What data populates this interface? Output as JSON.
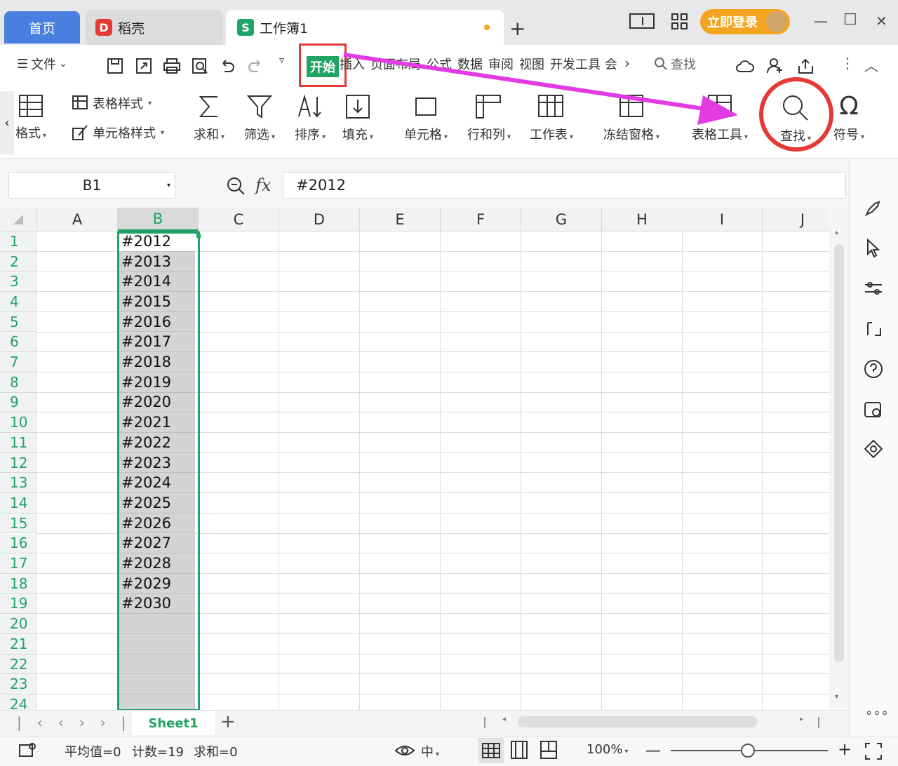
{
  "tabs": {
    "home": "首页",
    "daoke": "稻壳",
    "workbook": "工作簿1",
    "new_tab": "+"
  },
  "titlebar": {
    "login": "立即登录",
    "minimize": "—",
    "maximize": "☐",
    "close": "✕"
  },
  "menu": {
    "file": "文件",
    "start": "开始",
    "insert": "插入",
    "page_layout": "页面布局",
    "formula": "公式",
    "data": "数据",
    "review": "审阅",
    "view": "视图",
    "developer": "开发工具",
    "more": "会",
    "search": "查找"
  },
  "ribbon": {
    "table_format": "格式",
    "table_style": "表格样式",
    "cell_style": "单元格样式",
    "sum": "求和",
    "filter": "筛选",
    "sort": "排序",
    "fill": "填充",
    "cell": "单元格",
    "row_col": "行和列",
    "worksheet": "工作表",
    "freeze": "冻结窗格",
    "table_tools": "表格工具",
    "find": "查找",
    "symbol": "符号"
  },
  "formula_bar": {
    "name_box": "B1",
    "fx": "fx",
    "value": "#2012"
  },
  "columns": [
    "A",
    "B",
    "C",
    "D",
    "E",
    "F",
    "G",
    "H",
    "I",
    "J"
  ],
  "rows": [
    "1",
    "2",
    "3",
    "4",
    "5",
    "6",
    "7",
    "8",
    "9",
    "10",
    "11",
    "12",
    "13",
    "14",
    "15",
    "16",
    "17",
    "18",
    "19",
    "20",
    "21",
    "22",
    "23",
    "24"
  ],
  "column_b_values": [
    "#2012",
    "#2013",
    "#2014",
    "#2015",
    "#2016",
    "#2017",
    "#2018",
    "#2019",
    "#2020",
    "#2021",
    "#2022",
    "#2023",
    "#2024",
    "#2025",
    "#2026",
    "#2027",
    "#2028",
    "#2029",
    "#2030"
  ],
  "sheet": {
    "name": "Sheet1",
    "add": "+"
  },
  "status": {
    "average": "平均值=0",
    "count": "计数=19",
    "sum": "求和=0",
    "zoom": "100%"
  },
  "colors": {
    "accent": "#21a366",
    "highlight": "#e53935",
    "arrow": "#e33be3",
    "login": "#f3a51f"
  }
}
